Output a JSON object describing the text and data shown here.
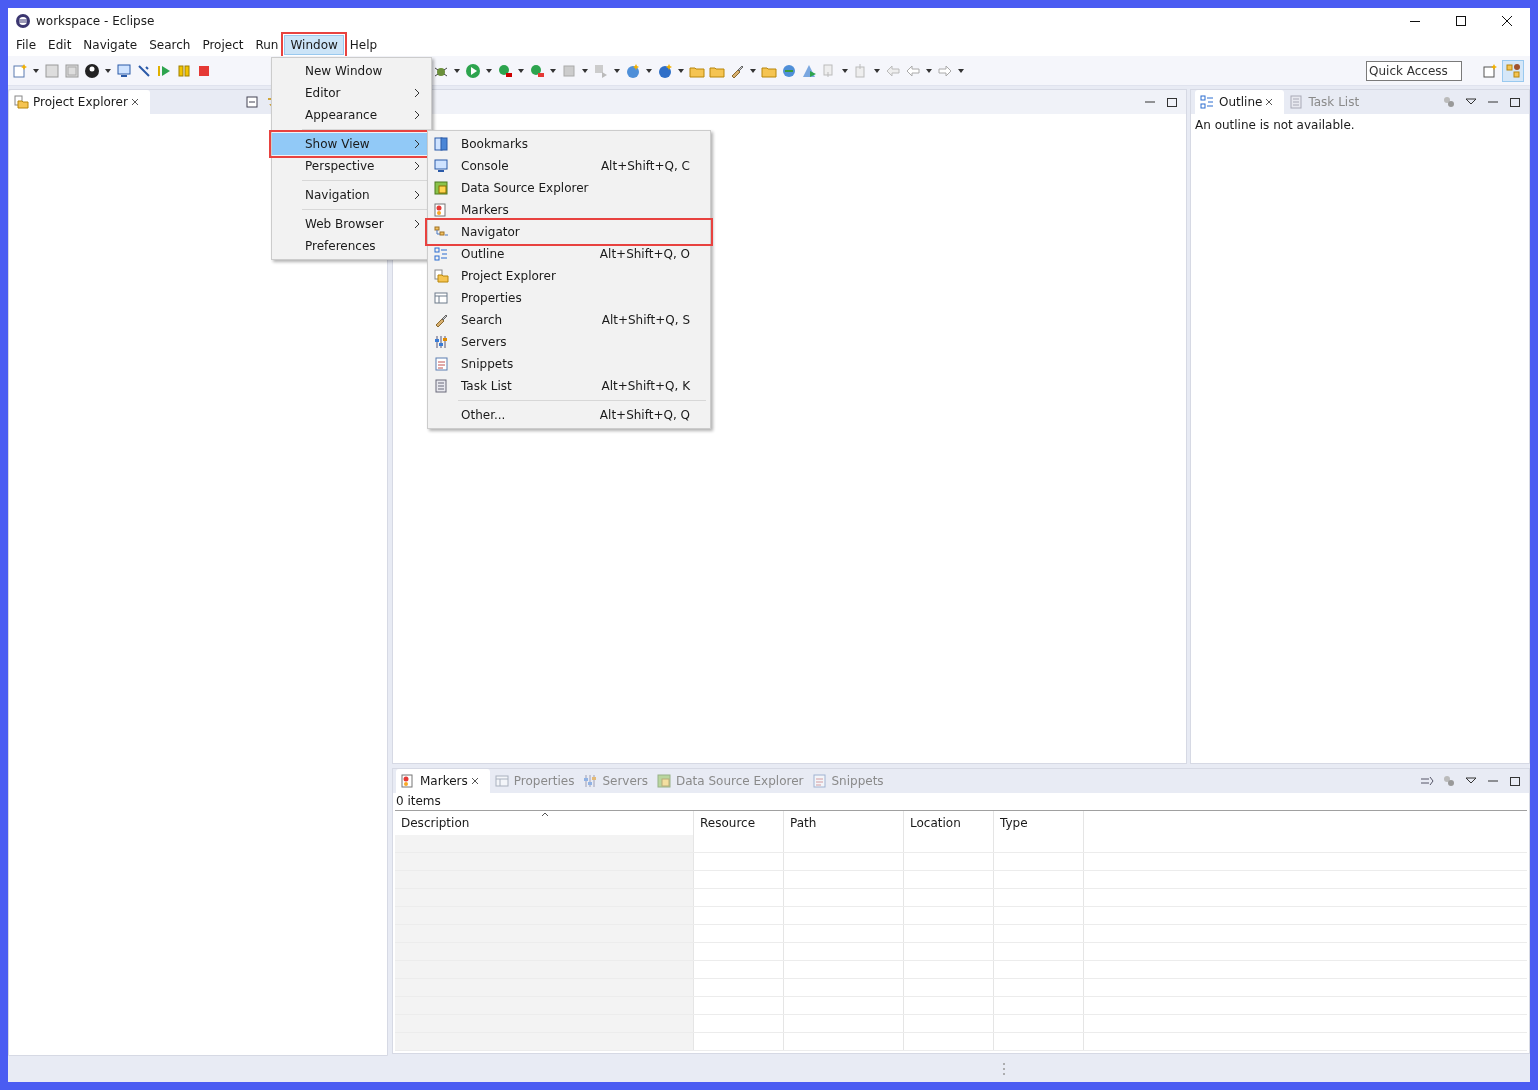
{
  "window": {
    "title": "workspace - Eclipse"
  },
  "menu_bar": [
    {
      "label": "File",
      "selected": false,
      "callout": false
    },
    {
      "label": "Edit",
      "selected": false,
      "callout": false
    },
    {
      "label": "Navigate",
      "selected": false,
      "callout": false
    },
    {
      "label": "Search",
      "selected": false,
      "callout": false
    },
    {
      "label": "Project",
      "selected": false,
      "callout": false
    },
    {
      "label": "Run",
      "selected": false,
      "callout": false
    },
    {
      "label": "Window",
      "selected": true,
      "callout": true
    },
    {
      "label": "Help",
      "selected": false,
      "callout": false
    }
  ],
  "quick_access": {
    "placeholder": "Quick Access"
  },
  "window_menu": [
    {
      "kind": "item",
      "label": "New Window",
      "submenu": false,
      "selected": false,
      "callout": false
    },
    {
      "kind": "item",
      "label": "Editor",
      "submenu": true,
      "selected": false,
      "callout": false
    },
    {
      "kind": "item",
      "label": "Appearance",
      "submenu": true,
      "selected": false,
      "callout": false
    },
    {
      "kind": "separator"
    },
    {
      "kind": "item",
      "label": "Show View",
      "submenu": true,
      "selected": true,
      "callout": true
    },
    {
      "kind": "item",
      "label": "Perspective",
      "submenu": true,
      "selected": false,
      "callout": false
    },
    {
      "kind": "separator"
    },
    {
      "kind": "item",
      "label": "Navigation",
      "submenu": true,
      "selected": false,
      "callout": false
    },
    {
      "kind": "separator"
    },
    {
      "kind": "item",
      "label": "Web Browser",
      "submenu": true,
      "selected": false,
      "callout": false
    },
    {
      "kind": "item",
      "label": "Preferences",
      "submenu": false,
      "selected": false,
      "callout": false
    }
  ],
  "show_view_menu": [
    {
      "kind": "item",
      "label": "Bookmarks",
      "callout": false
    },
    {
      "kind": "item",
      "label": "Console",
      "shortcut": "Alt+Shift+Q, C",
      "callout": false
    },
    {
      "kind": "item",
      "label": "Data Source Explorer",
      "callout": false
    },
    {
      "kind": "item",
      "label": "Markers",
      "callout": false
    },
    {
      "kind": "item",
      "label": "Navigator",
      "callout": true
    },
    {
      "kind": "item",
      "label": "Outline",
      "shortcut": "Alt+Shift+Q, O",
      "callout": false
    },
    {
      "kind": "item",
      "label": "Project Explorer",
      "callout": false
    },
    {
      "kind": "item",
      "label": "Properties",
      "callout": false
    },
    {
      "kind": "item",
      "label": "Search",
      "shortcut": "Alt+Shift+Q, S",
      "callout": false
    },
    {
      "kind": "item",
      "label": "Servers",
      "callout": false
    },
    {
      "kind": "item",
      "label": "Snippets",
      "callout": false
    },
    {
      "kind": "item",
      "label": "Task List",
      "shortcut": "Alt+Shift+Q, K",
      "callout": false
    },
    {
      "kind": "separator"
    },
    {
      "kind": "item",
      "label": "Other...",
      "shortcut": "Alt+Shift+Q, Q",
      "callout": false
    }
  ],
  "left_panel": {
    "tabs": [
      {
        "label": "Project Explorer",
        "selected": true
      }
    ]
  },
  "right_panel": {
    "tabs": [
      {
        "label": "Outline",
        "selected": true
      },
      {
        "label": "Task List",
        "selected": false
      }
    ],
    "message": "An outline is not available."
  },
  "bottom_panel": {
    "tabs": [
      {
        "label": "Markers",
        "selected": true
      },
      {
        "label": "Properties",
        "selected": false
      },
      {
        "label": "Servers",
        "selected": false
      },
      {
        "label": "Data Source Explorer",
        "selected": false
      },
      {
        "label": "Snippets",
        "selected": false
      }
    ],
    "count": "0 items",
    "table": {
      "columns": [
        "Description",
        "Resource",
        "Path",
        "Location",
        "Type"
      ]
    }
  }
}
